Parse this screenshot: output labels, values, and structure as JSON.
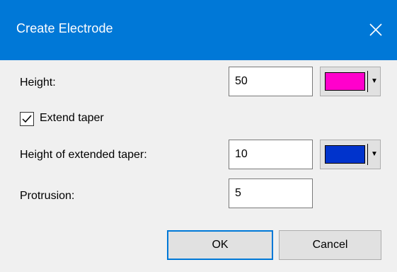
{
  "window": {
    "title": "Create Electrode",
    "close_glyph": "close-icon"
  },
  "fields": {
    "height": {
      "label": "Height:",
      "value": "50",
      "color": "#ff00cc"
    },
    "extend_taper": {
      "label": "Extend taper",
      "checked": true
    },
    "height_extended_taper": {
      "label": "Height of extended taper:",
      "value": "10",
      "color": "#0033cc"
    },
    "protrusion": {
      "label": "Protrusion:",
      "value": "5"
    }
  },
  "buttons": {
    "ok": "OK",
    "cancel": "Cancel"
  }
}
